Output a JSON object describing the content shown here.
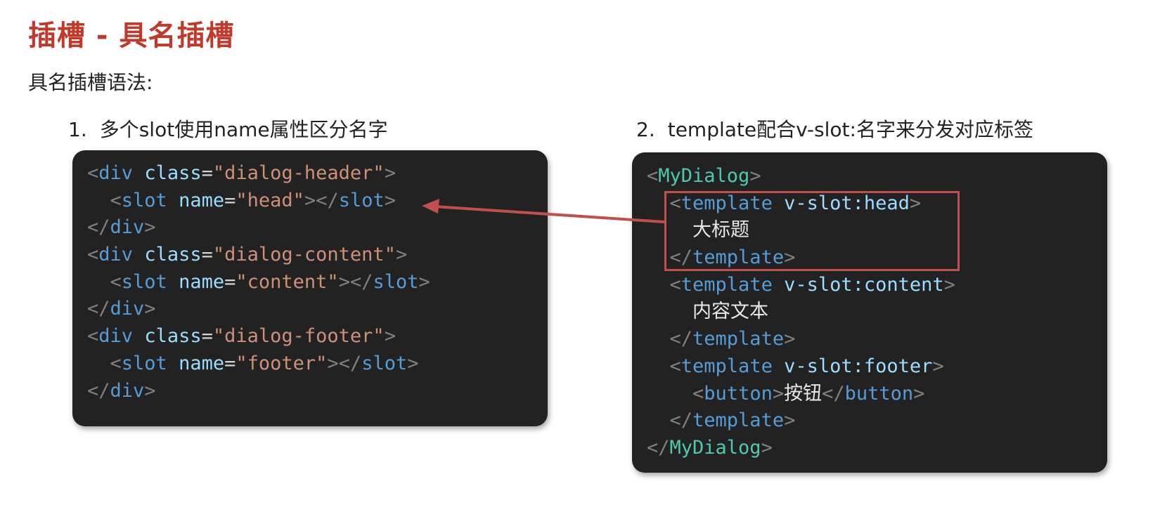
{
  "page": {
    "title": "插槽 - 具名插槽",
    "subtitle": "具名插槽语法:",
    "steps": [
      {
        "num": "1.",
        "text": "多个slot使用name属性区分名字"
      },
      {
        "num": "2.",
        "text": "template配合v-slot:名字来分发对应标签"
      }
    ]
  },
  "colors": {
    "title": "#c0392b",
    "code_bg": "#222222",
    "punctuation": "#808080",
    "tag": "#569cd6",
    "component": "#4ec9b0",
    "attr": "#9cdcfe",
    "string": "#ce9178",
    "highlight_border": "#c0504d"
  },
  "code_left": {
    "line1": {
      "open": "<",
      "tag": "div",
      "attr": "class",
      "eq": "=",
      "val": "\"dialog-header\"",
      "close": ">"
    },
    "line2": {
      "indent": "  ",
      "open": "<",
      "tag": "slot",
      "attr": "name",
      "eq": "=",
      "val": "\"head\"",
      "close": ">",
      "end_open": "</",
      "end_tag": "slot",
      "end_close": ">"
    },
    "line3": {
      "end_open": "</",
      "end_tag": "div",
      "end_close": ">"
    },
    "line4": {
      "open": "<",
      "tag": "div",
      "attr": "class",
      "eq": "=",
      "val": "\"dialog-content\"",
      "close": ">"
    },
    "line5": {
      "indent": "  ",
      "open": "<",
      "tag": "slot",
      "attr": "name",
      "eq": "=",
      "val": "\"content\"",
      "close": ">",
      "end_open": "</",
      "end_tag": "slot",
      "end_close": ">"
    },
    "line6": {
      "end_open": "</",
      "end_tag": "div",
      "end_close": ">"
    },
    "line7": {
      "open": "<",
      "tag": "div",
      "attr": "class",
      "eq": "=",
      "val": "\"dialog-footer\"",
      "close": ">"
    },
    "line8": {
      "indent": "  ",
      "open": "<",
      "tag": "slot",
      "attr": "name",
      "eq": "=",
      "val": "\"footer\"",
      "close": ">",
      "end_open": "</",
      "end_tag": "slot",
      "end_close": ">"
    },
    "line9": {
      "end_open": "</",
      "end_tag": "div",
      "end_close": ">"
    }
  },
  "code_right": {
    "line1": {
      "open": "<",
      "tag": "MyDialog",
      "close": ">"
    },
    "line2": {
      "indent": "  ",
      "open": "<",
      "tag": "template",
      "sp": " ",
      "attr": "v-slot:head",
      "close": ">"
    },
    "line3": {
      "indent": "    ",
      "text": "大标题"
    },
    "line4": {
      "indent": "  ",
      "end_open": "</",
      "end_tag": "template",
      "end_close": ">"
    },
    "line5": {
      "indent": "  ",
      "open": "<",
      "tag": "template",
      "sp": " ",
      "attr": "v-slot:content",
      "close": ">"
    },
    "line6": {
      "indent": "    ",
      "text": "内容文本"
    },
    "line7": {
      "indent": "  ",
      "end_open": "</",
      "end_tag": "template",
      "end_close": ">"
    },
    "line8": {
      "indent": "  ",
      "open": "<",
      "tag": "template",
      "sp": " ",
      "attr": "v-slot:footer",
      "close": ">"
    },
    "line9": {
      "indent": "    ",
      "open": "<",
      "tag": "button",
      "close": ">",
      "text": "按钮",
      "end_open": "</",
      "end_tag": "button",
      "end_close": ">"
    },
    "line10": {
      "indent": "  ",
      "end_open": "</",
      "end_tag": "template",
      "end_close": ">"
    },
    "line11": {
      "end_open": "</",
      "end_tag": "MyDialog",
      "end_close": ">"
    }
  }
}
